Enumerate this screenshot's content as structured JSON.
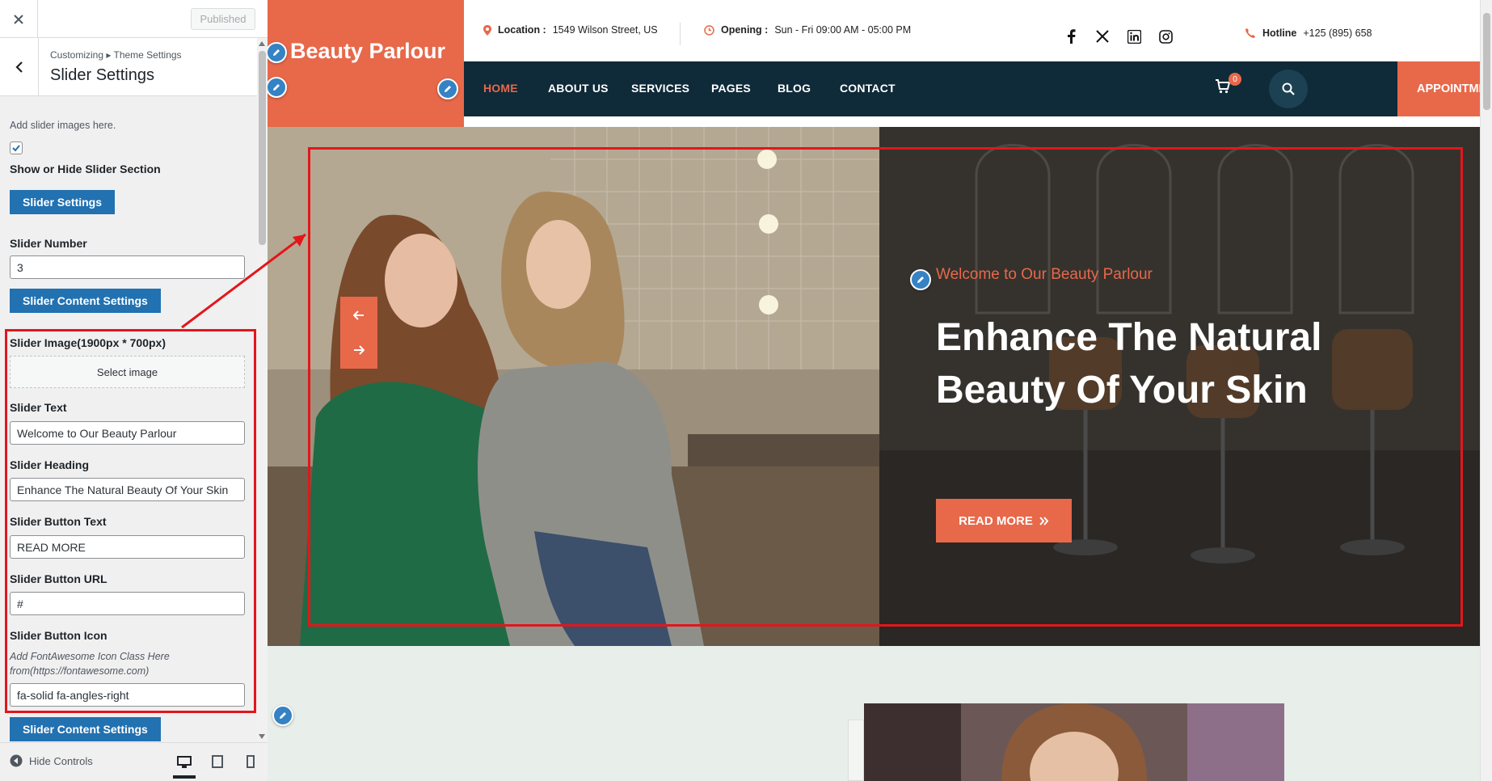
{
  "customizer": {
    "published_label": "Published",
    "breadcrumb": "Customizing ▸ Theme Settings",
    "section_title": "Slider Settings",
    "intro_text": "Add slider images here.",
    "show_hide_label": "Show or Hide Slider Section",
    "show_hide_checked": true,
    "slider_settings_btn": "Slider Settings",
    "slider_number_label": "Slider Number",
    "slider_number_value": "3",
    "content_settings_btn": "Slider Content Settings",
    "slider_image_label": "Slider Image(1900px * 700px)",
    "select_image_btn": "Select image",
    "slider_text_label": "Slider Text",
    "slider_text_value": "Welcome to Our Beauty Parlour",
    "slider_heading_label": "Slider Heading",
    "slider_heading_value": "Enhance The Natural Beauty Of Your Skin",
    "slider_button_text_label": "Slider Button Text",
    "slider_button_text_value": "READ MORE",
    "slider_button_url_label": "Slider Button URL",
    "slider_button_url_value": "#",
    "slider_button_icon_label": "Slider Button Icon",
    "slider_button_icon_desc": "Add FontAwesome Icon Class Here from(https://fontawesome.com)",
    "slider_button_icon_value": "fa-solid fa-angles-right",
    "content_settings_btn_2": "Slider Content Settings",
    "hide_controls": "Hide Controls"
  },
  "site": {
    "logo": "Beauty Parlour",
    "location_label": "Location :",
    "location_value": "1549 Wilson Street, US",
    "opening_label": "Opening :",
    "opening_value": "Sun - Fri 09:00 AM - 05:00 PM",
    "hotline_label": "Hotline",
    "hotline_value": "+125 (895) 658",
    "nav": [
      "HOME",
      "ABOUT US",
      "SERVICES",
      "PAGES",
      "BLOG",
      "CONTACT"
    ],
    "cart_count": "0",
    "appointment_btn": "APPOINTMENT NOW",
    "hero_sub": "Welcome to Our Beauty Parlour",
    "hero_title": "Enhance The Natural Beauty Of Your Skin",
    "read_more": "READ MORE"
  },
  "colors": {
    "accent": "#e8684a",
    "navy": "#0f2a38",
    "wp_blue": "#2271b1",
    "highlight_red": "#e3161b"
  }
}
